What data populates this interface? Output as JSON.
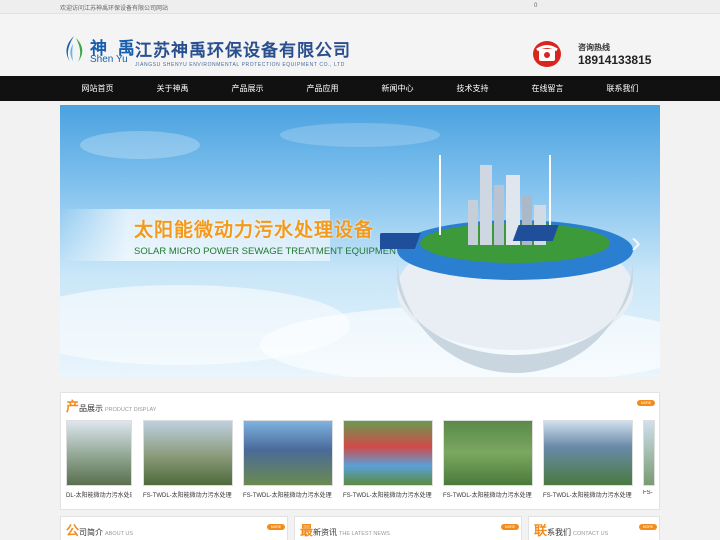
{
  "topbar": {
    "welcome": "欢迎访问江苏神禹环保设备有限公司网站",
    "count": "0"
  },
  "logo": {
    "cn": "神 禹",
    "en": "Shen Yu"
  },
  "company": {
    "cn": "江苏神禹环保设备有限公司",
    "en": "JIANGSU SHENYU ENVIRONMENTAL PROTECTION EQUIPMENT CO., LTD"
  },
  "hotline": {
    "label": "咨询热线",
    "number": "18914133815"
  },
  "nav": [
    {
      "label": "网站首页"
    },
    {
      "label": "关于神禹"
    },
    {
      "label": "产品展示"
    },
    {
      "label": "产品应用"
    },
    {
      "label": "新闻中心"
    },
    {
      "label": "技术支持"
    },
    {
      "label": "在线留言"
    },
    {
      "label": "联系我们"
    }
  ],
  "banner": {
    "title": "太阳能微动力污水处理设备",
    "subtitle": "SOLAR MICRO POWER SEWAGE TREATMENT EQUIPMENT",
    "next_arrow": "›"
  },
  "products_section": {
    "big": "产",
    "cn": "品展示",
    "en": "PRODUCT DISPLAY",
    "more": "MORE"
  },
  "products": [
    {
      "caption": "DL-太阳能微动力污水处理"
    },
    {
      "caption": "FS-TWDL-太阳能微动力污水处理"
    },
    {
      "caption": "FS-TWDL-太阳能微动力污水处理"
    },
    {
      "caption": "FS-TWDL-太阳能微动力污水处理"
    },
    {
      "caption": "FS-TWDL-太阳能微动力污水处理"
    },
    {
      "caption": "FS-TWDL-太阳能微动力污水处理"
    },
    {
      "caption": "FS-"
    }
  ],
  "about_section": {
    "big": "公",
    "cn": "司简介",
    "en": "ABOUT US",
    "more": "MORE"
  },
  "news_section": {
    "big": "最",
    "cn": "新资讯",
    "en": "THE LATEST NEWS",
    "more": "MORE"
  },
  "contact_section": {
    "big": "联",
    "cn": "系我们",
    "en": "CONTACT US",
    "more": "MORE"
  },
  "colors": {
    "accent": "#f28c1d",
    "nav_bg": "#111111",
    "brand_blue": "#1a5fae"
  }
}
